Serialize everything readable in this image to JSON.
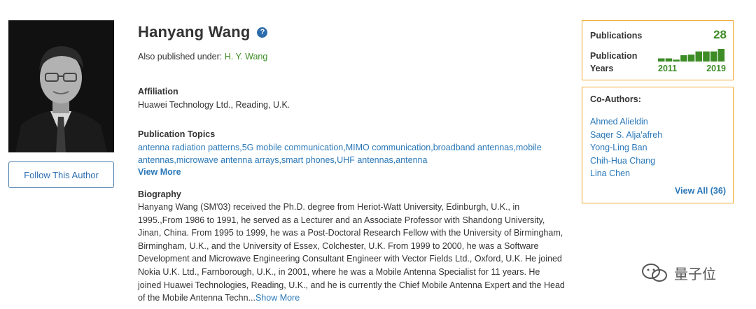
{
  "author": {
    "name": "Hanyang Wang",
    "help_symbol": "?",
    "also_published_label": "Also published under: ",
    "also_published_name": "H. Y. Wang",
    "follow_label": "Follow This Author"
  },
  "affiliation": {
    "title": "Affiliation",
    "text": "Huawei Technology Ltd., Reading, U.K."
  },
  "topics": {
    "title": "Publication Topics",
    "text": "antenna radiation patterns,5G mobile communication,MIMO communication,broadband antennas,mobile antennas,microwave antenna arrays,smart phones,UHF antennas,antenna",
    "view_more": "View More"
  },
  "biography": {
    "title": "Biography",
    "text": "Hanyang Wang (SM'03) received the Ph.D. degree from Heriot-Watt University, Edinburgh, U.K., in 1995.,From 1986 to 1991, he served as a Lecturer and an Associate Professor with Shandong University, Jinan, China. From 1995 to 1999, he was a Post-Doctoral Research Fellow with the University of Birmingham, Birmingham, U.K., and the University of Essex, Colchester, U.K. From 1999 to 2000, he was a Software Development and Microwave Engineering Consultant Engineer with Vector Fields Ltd., Oxford, U.K. He joined Nokia U.K. Ltd., Farnborough, U.K., in 2001, where he was a Mobile Antenna Specialist for 11 years. He joined Huawei Technologies, Reading, U.K., and he is currently the Chief Mobile Antenna Expert and the Head of the Mobile Antenna Techn...",
    "show_more": "Show More"
  },
  "stats": {
    "publications_label": "Publications",
    "publications_count": "28",
    "years_label_line1": "Publication",
    "years_label_line2": "Years",
    "year_start": "2011",
    "year_end": "2019",
    "sparkline_relative": [
      0.25,
      0.25,
      0.15,
      0.5,
      0.55,
      0.8,
      0.8,
      0.8,
      1.0
    ],
    "accent_color": "#3d8c26"
  },
  "coauthors": {
    "title": "Co-Authors:",
    "names": [
      "Ahmed Alieldin",
      "Saqer S. Alja'afreh",
      "Yong-Ling Ban",
      "Chih-Hua Chang",
      "Lina Chen"
    ],
    "view_all": "View All (36)"
  },
  "watermark": {
    "text": "量子位"
  },
  "colors": {
    "box_border": "#f0a830",
    "link": "#2b78b8",
    "green": "#3d8c26"
  }
}
